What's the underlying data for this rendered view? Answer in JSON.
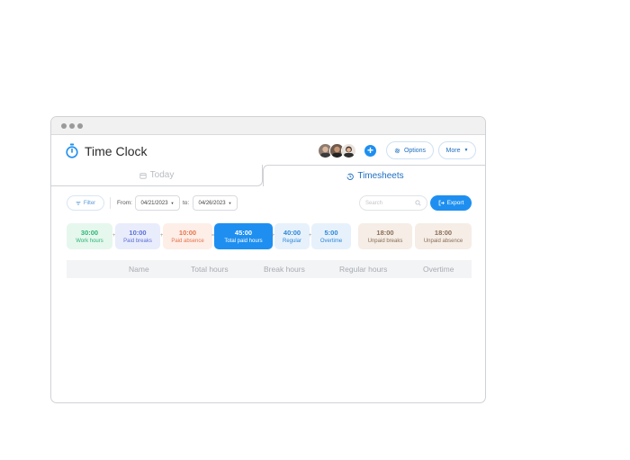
{
  "app": {
    "title": "Time Clock"
  },
  "header": {
    "options_label": "Options",
    "more_label": "More",
    "add_icon": "plus-circle-icon"
  },
  "tabs": [
    {
      "label": "Today",
      "active": false,
      "icon": "calendar-icon"
    },
    {
      "label": "Timesheets",
      "active": true,
      "icon": "history-icon"
    }
  ],
  "toolbar": {
    "filter_label": "Filter",
    "from_label": "From:",
    "from_date": "04/21/2023",
    "to_label": "to:",
    "to_date": "04/26/2023",
    "search_placeholder": "Search",
    "export_label": "Export"
  },
  "summary": [
    {
      "value": "30:00",
      "label": "Work hours",
      "color": "#2bb673",
      "bg": "#e6f7ee"
    },
    {
      "value": "10:00",
      "label": "Paid breaks",
      "color": "#5b6fd6",
      "bg": "#e9ecfb"
    },
    {
      "value": "10:00",
      "label": "Paid absence",
      "color": "#e8734a",
      "bg": "#fdeee8"
    },
    {
      "value": "45:00",
      "label": "Total paid hours",
      "color": "#ffffff",
      "bg": "#1e8ff0"
    },
    {
      "value": "40:00",
      "label": "Regular",
      "color": "#2b87d8",
      "bg": "#e7f1fb"
    },
    {
      "value": "5:00",
      "label": "Overtime",
      "color": "#2b87d8",
      "bg": "#e7f1fb"
    },
    {
      "value": "18:00",
      "label": "Unpaid breaks",
      "color": "#8a6d55",
      "bg": "#f5ede6"
    },
    {
      "value": "18:00",
      "label": "Unpaid absence",
      "color": "#8a6d55",
      "bg": "#f5ede6"
    }
  ],
  "operators": [
    "+",
    "+",
    "=",
    "+",
    "+"
  ],
  "table": {
    "columns": [
      "Name",
      "Total hours",
      "Break hours",
      "Regular hours",
      "Overtime"
    ]
  },
  "colors": {
    "accent": "#1e8ff0"
  }
}
